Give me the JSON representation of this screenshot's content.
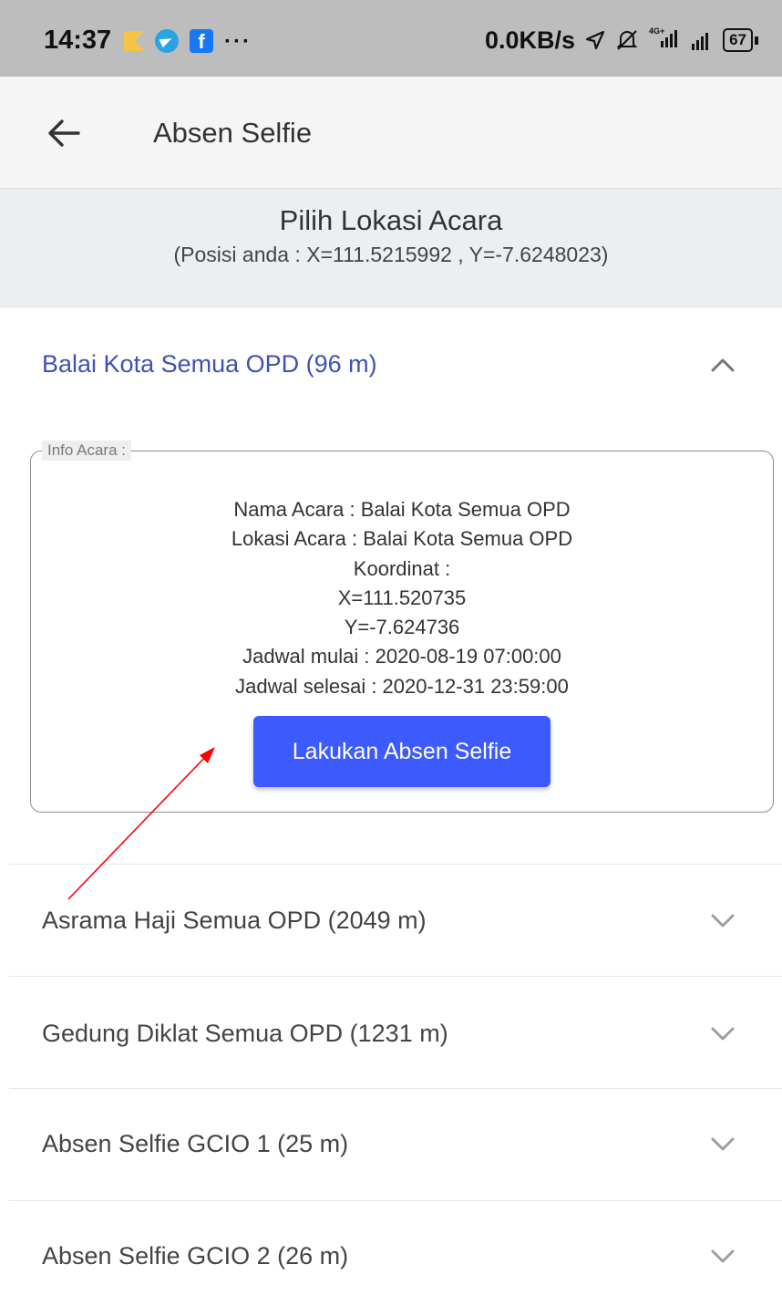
{
  "status_bar": {
    "time": "14:37",
    "notification_icons": [
      "flag-icon",
      "telegram-icon",
      "facebook-icon",
      "more-icon"
    ],
    "more_text": "···",
    "network_speed": "0.0KB/s",
    "signal_4g": "4G+",
    "battery": "67"
  },
  "app_bar": {
    "back_icon": "arrow-left-icon",
    "title": "Absen Selfie"
  },
  "location_header": {
    "title": "Pilih Lokasi Acara",
    "position": "(Posisi anda : X=111.5215992 , Y=-7.6248023)"
  },
  "locations": [
    {
      "label": "Balai Kota Semua OPD (96 m)",
      "expanded": true,
      "info": {
        "legend": "Info Acara :",
        "lines": [
          "Nama Acara : Balai Kota Semua OPD",
          "Lokasi Acara : Balai Kota Semua OPD",
          "Koordinat :",
          "X=111.520735",
          "Y=-7.624736",
          "Jadwal mulai : 2020-08-19 07:00:00",
          "Jadwal selesai : 2020-12-31 23:59:00"
        ],
        "button_label": "Lakukan Absen Selfie"
      }
    },
    {
      "label": "Asrama Haji Semua OPD (2049 m)",
      "expanded": false
    },
    {
      "label": "Gedung Diklat Semua OPD (1231 m)",
      "expanded": false
    },
    {
      "label": "Absen Selfie GCIO 1 (25 m)",
      "expanded": false
    },
    {
      "label": "Absen Selfie GCIO 2 (26 m)",
      "expanded": false
    }
  ],
  "colors": {
    "accent": "#3d5afe",
    "expanded_label": "#3f51b5",
    "annotation_arrow": "#ff0000",
    "status_bar_bg": "#bdbdbd",
    "header_bg": "#eceff1"
  }
}
